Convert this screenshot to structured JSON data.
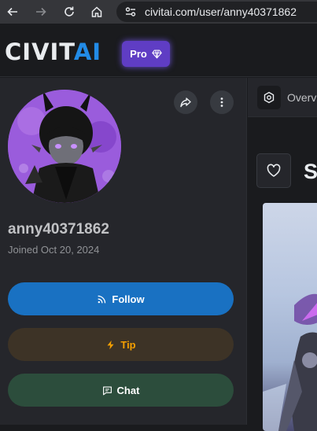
{
  "browser": {
    "url": "civitai.com/user/anny40371862",
    "icons": [
      "back-arrow-icon",
      "forward-arrow-icon",
      "reload-icon",
      "home-icon",
      "site-info-icon"
    ]
  },
  "header": {
    "logo": {
      "part1": "CIVIT",
      "part2": "AI"
    },
    "pro_label": "Pro",
    "colors": {
      "accent": "#228be6",
      "pro": "#5f3dc4"
    }
  },
  "profile": {
    "username": "anny40371862",
    "joined": "Joined Oct 20, 2024",
    "buttons": {
      "follow": "Follow",
      "tip": "Tip",
      "chat": "Chat"
    },
    "colors": {
      "follow": "#1971c2",
      "tip_bg": "#3d3326",
      "tip_text": "#f59f00",
      "chat": "#2c4d3c"
    }
  },
  "main": {
    "tab_overview": "Overview",
    "section_title_partial": "S"
  }
}
